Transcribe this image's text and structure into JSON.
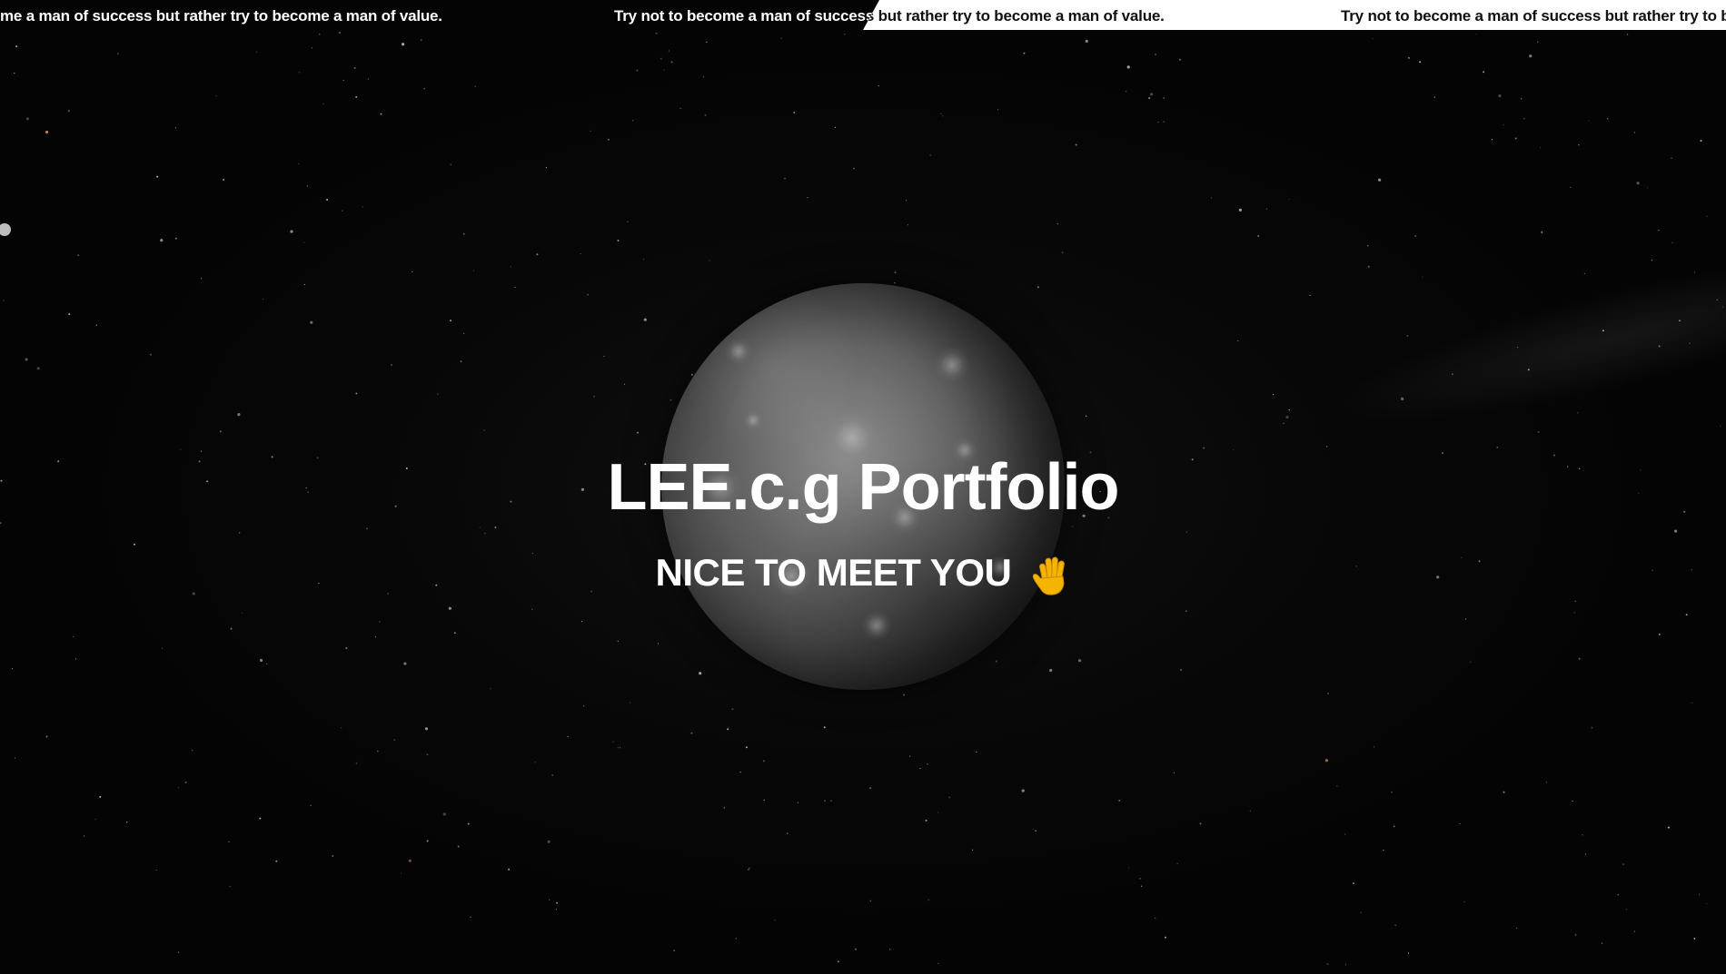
{
  "ticker": {
    "segments": [
      "me a man of success but rather try to become a man of value.",
      "Try not to become a man of success but rather try to become a man of value.",
      "Try not to become a man of success but rather try to become a man of value."
    ],
    "colors": {
      "dark_text": "#ffffff",
      "light_bg": "#ffffff",
      "light_text": "#111111"
    }
  },
  "hero": {
    "title": "LEE.c.g Portfolio",
    "subtitle": "NICE TO MEET YOU",
    "subtitle_icon": "waving-hand-icon"
  },
  "colors": {
    "background": "#060606",
    "text": "#ffffff",
    "side_dot": "#bdbdbd"
  }
}
